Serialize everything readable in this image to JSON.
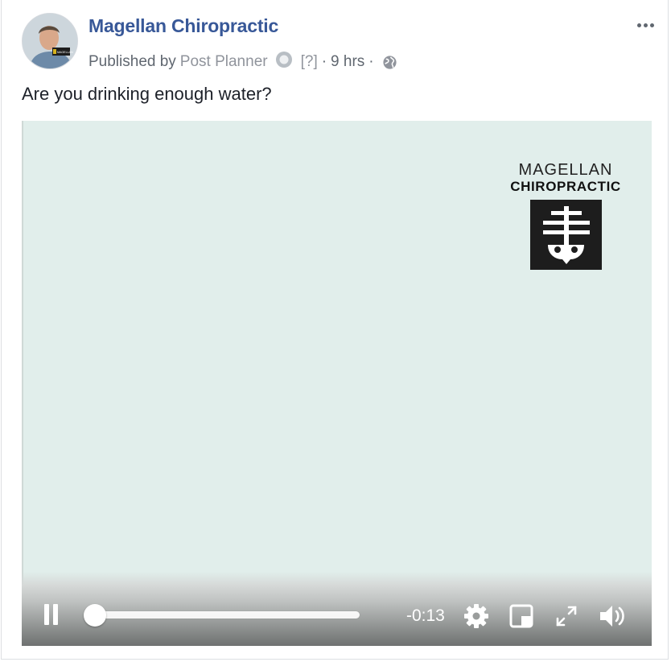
{
  "post": {
    "page_name": "Magellan Chiropractic",
    "published_by_prefix": "Published by",
    "publisher": "Post Planner",
    "help": "[?]",
    "separator": "·",
    "time_ago": "9 hrs",
    "text": "Are you drinking enough water?"
  },
  "avatar": {
    "badge_text": "MAGELLAN"
  },
  "video": {
    "logo_line1": "MAGELLAN",
    "logo_line2": "CHIROPRACTIC",
    "time_remaining": "-0:13",
    "progress": 0.0
  },
  "icons": {
    "more": "more-options-icon",
    "publisher": "post-planner-icon",
    "audience": "globe-icon",
    "play_state": "pause-icon",
    "settings": "gear-icon",
    "pip": "picture-in-picture-icon",
    "fullscreen": "fullscreen-icon",
    "volume": "volume-icon"
  },
  "colors": {
    "page_name": "#385898",
    "meta_text": "#606770",
    "video_bg": "#e1eeeb"
  }
}
